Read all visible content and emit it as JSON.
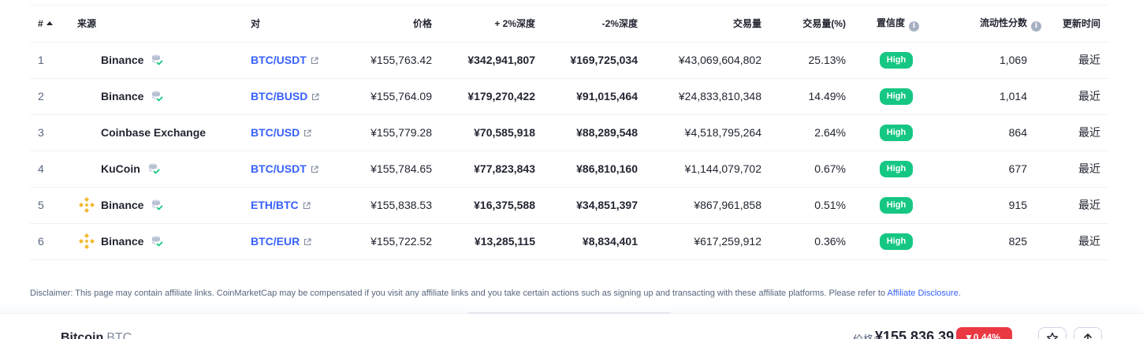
{
  "table": {
    "headers": {
      "rank": "#",
      "source": "来源",
      "pair": "对",
      "price": "价格",
      "depth_plus": "+ 2%深度",
      "depth_minus": "-2%深度",
      "volume": "交易量",
      "volume_pct": "交易量(%)",
      "confidence": "置信度",
      "liquidity": "流动性分数",
      "updated": "更新时间"
    },
    "info_icon_glyph": "i",
    "rows": [
      {
        "rank": "1",
        "exchange": "Binance",
        "logo": "none",
        "verified": true,
        "pair": "BTC/USDT",
        "price": "¥155,763.42",
        "depth_plus": "¥342,941,807",
        "depth_minus": "¥169,725,034",
        "volume": "¥43,069,604,802",
        "volume_pct": "25.13%",
        "confidence": "High",
        "liquidity": "1,069",
        "updated": "最近"
      },
      {
        "rank": "2",
        "exchange": "Binance",
        "logo": "none",
        "verified": true,
        "pair": "BTC/BUSD",
        "price": "¥155,764.09",
        "depth_plus": "¥179,270,422",
        "depth_minus": "¥91,015,464",
        "volume": "¥24,833,810,348",
        "volume_pct": "14.49%",
        "confidence": "High",
        "liquidity": "1,014",
        "updated": "最近"
      },
      {
        "rank": "3",
        "exchange": "Coinbase Exchange",
        "logo": "none",
        "verified": false,
        "pair": "BTC/USD",
        "price": "¥155,779.28",
        "depth_plus": "¥70,585,918",
        "depth_minus": "¥88,289,548",
        "volume": "¥4,518,795,264",
        "volume_pct": "2.64%",
        "confidence": "High",
        "liquidity": "864",
        "updated": "最近"
      },
      {
        "rank": "4",
        "exchange": "KuCoin",
        "logo": "none",
        "verified": true,
        "pair": "BTC/USDT",
        "price": "¥155,784.65",
        "depth_plus": "¥77,823,843",
        "depth_minus": "¥86,810,160",
        "volume": "¥1,144,079,702",
        "volume_pct": "0.67%",
        "confidence": "High",
        "liquidity": "677",
        "updated": "最近"
      },
      {
        "rank": "5",
        "exchange": "Binance",
        "logo": "binance-logo",
        "verified": true,
        "pair": "ETH/BTC",
        "price": "¥155,838.53",
        "depth_plus": "¥16,375,588",
        "depth_minus": "¥34,851,397",
        "volume": "¥867,961,858",
        "volume_pct": "0.51%",
        "confidence": "High",
        "liquidity": "915",
        "updated": "最近"
      },
      {
        "rank": "6",
        "exchange": "Binance",
        "logo": "binance-logo",
        "verified": true,
        "pair": "BTC/EUR",
        "price": "¥155,722.52",
        "depth_plus": "¥13,285,115",
        "depth_minus": "¥8,834,401",
        "volume": "¥617,259,912",
        "volume_pct": "0.36%",
        "confidence": "High",
        "liquidity": "825",
        "updated": "最近"
      }
    ]
  },
  "disclaimer": {
    "text": "Disclaimer: This page may contain affiliate links. CoinMarketCap may be compensated if you visit any affiliate links and you take certain actions such as signing up and transacting with these affiliate platforms. Please refer to ",
    "link_label": "Affiliate Disclosure",
    "suffix": "."
  },
  "bottom_bar": {
    "coin_name": "Bitcoin",
    "coin_symbol": "BTC",
    "price_label": "价格:",
    "price_value": "¥155,836.39",
    "change": "▼0.44%"
  },
  "colors": {
    "accent_link": "#3861fb",
    "high_badge": "#16c784",
    "down_badge": "#ea3943",
    "binance_yellow": "#f3ba2f"
  },
  "icons": [
    "sort-up-icon",
    "info-icon",
    "verified-icon",
    "external-link-icon",
    "binance-logo",
    "star-icon",
    "share-icon"
  ]
}
